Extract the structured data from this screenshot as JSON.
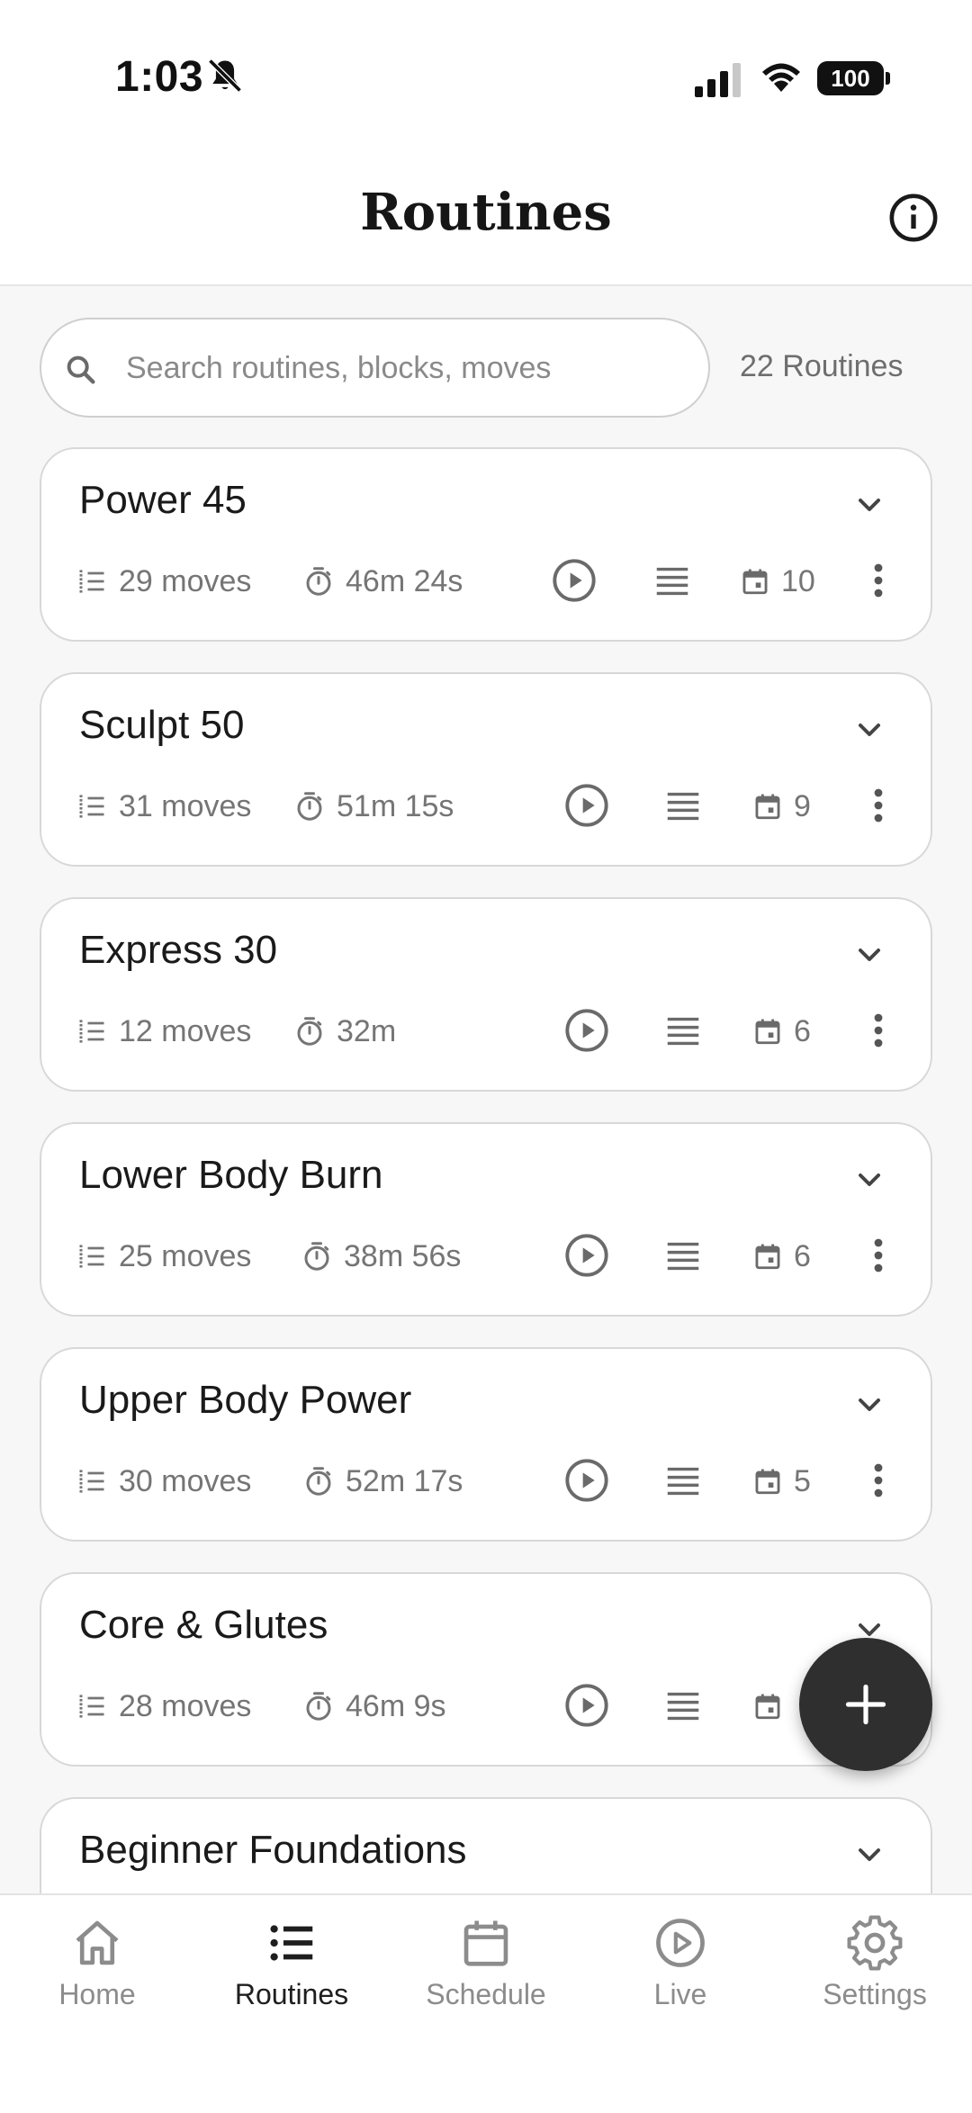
{
  "status_bar": {
    "time": "1:03",
    "battery": "100"
  },
  "header": {
    "title": "Routines"
  },
  "search": {
    "placeholder": "Search routines, blocks, moves",
    "value": ""
  },
  "routine_count": "22 Routines",
  "routines": [
    {
      "name": "Power 45",
      "moves": "29 moves",
      "duration": "46m 24s",
      "scheduled": "10"
    },
    {
      "name": "Sculpt 50",
      "moves": "31 moves",
      "duration": "51m 15s",
      "scheduled": "9"
    },
    {
      "name": "Express 30",
      "moves": "12 moves",
      "duration": "32m",
      "scheduled": "6"
    },
    {
      "name": "Lower Body Burn",
      "moves": "25 moves",
      "duration": "38m 56s",
      "scheduled": "6"
    },
    {
      "name": "Upper Body Power",
      "moves": "30 moves",
      "duration": "52m 17s",
      "scheduled": "5"
    },
    {
      "name": "Core & Glutes",
      "moves": "28 moves",
      "duration": "46m 9s",
      "scheduled": ""
    },
    {
      "name": "Beginner Foundations"
    }
  ],
  "nav": {
    "items": [
      {
        "label": "Home",
        "icon": "home-icon"
      },
      {
        "label": "Routines",
        "icon": "list-icon",
        "active": true
      },
      {
        "label": "Schedule",
        "icon": "calendar-icon"
      },
      {
        "label": "Live",
        "icon": "play-circle-icon"
      },
      {
        "label": "Settings",
        "icon": "gear-icon"
      }
    ]
  },
  "colors": {
    "fab": "#2f2f2f",
    "active_nav": "#1e1e1e",
    "inactive_nav": "#8c8c8c"
  }
}
